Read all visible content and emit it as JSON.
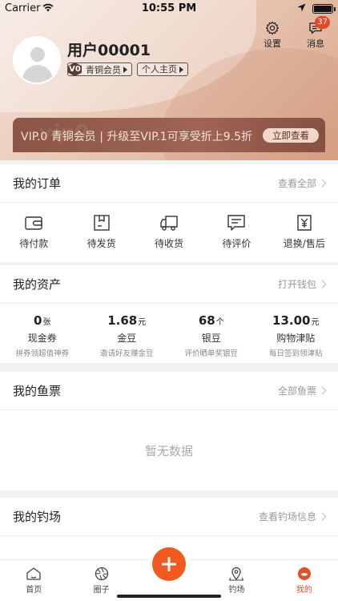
{
  "status_bar": {
    "carrier": "Carrier",
    "time": "10:55 PM"
  },
  "profile": {
    "username": "用户00001",
    "vip_hex": "V0",
    "member_label": "青铜会员",
    "homepage_label": "个人主页"
  },
  "top_actions": {
    "settings_label": "设置",
    "messages_label": "消息",
    "messages_count": "37"
  },
  "vip_banner": {
    "watermark": "vip0",
    "text": "VIP.0 青铜会员 | 升级至VIP.1可享受折上9.5折",
    "button": "立即查看"
  },
  "orders": {
    "title": "我的订单",
    "link": "查看全部",
    "items": [
      {
        "label": "待付款",
        "icon": "wallet-icon"
      },
      {
        "label": "待发货",
        "icon": "box-icon"
      },
      {
        "label": "待收货",
        "icon": "truck-icon"
      },
      {
        "label": "待评价",
        "icon": "comment-icon"
      },
      {
        "label": "退换/售后",
        "icon": "refund-icon"
      }
    ]
  },
  "assets": {
    "title": "我的资产",
    "link": "打开钱包",
    "items": [
      {
        "value": "0",
        "unit": "张",
        "name": "现金券",
        "sub": "拼券领超值神券"
      },
      {
        "value": "1.68",
        "unit": "元",
        "name": "金豆",
        "sub": "邀请好友赚金豆"
      },
      {
        "value": "68",
        "unit": "个",
        "name": "银豆",
        "sub": "评价晒单奖银豆"
      },
      {
        "value": "13.00",
        "unit": "元",
        "name": "购物津贴",
        "sub": "每日签到领津贴"
      }
    ]
  },
  "tickets": {
    "title": "我的鱼票",
    "link": "全部鱼票",
    "empty": "暂无数据"
  },
  "venues": {
    "title": "我的钓场",
    "link": "查看钓场信息"
  },
  "tabbar": {
    "home": "首页",
    "circle": "圈子",
    "venue": "钓场",
    "mine": "我的"
  },
  "colors": {
    "accent": "#f05a20",
    "badge": "#e04a2a",
    "banner": "#9e6454"
  }
}
